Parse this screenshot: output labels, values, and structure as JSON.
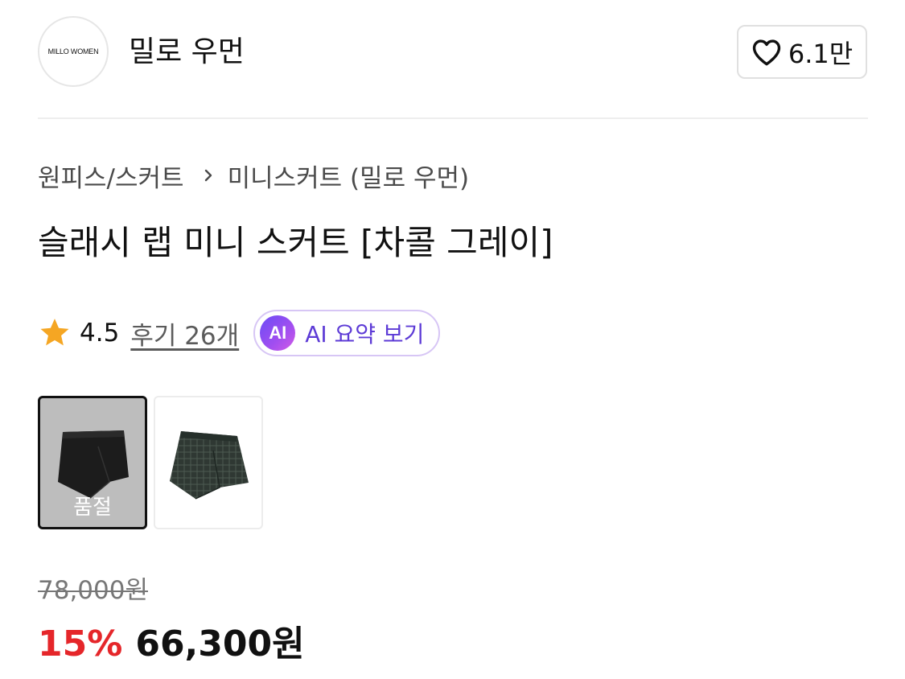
{
  "brand": {
    "logo_text": "MILLO WOMEN",
    "name": "밀로 우먼",
    "like_count": "6.1만"
  },
  "breadcrumb": {
    "category": "원피스/스커트",
    "subcategory": "미니스커트 (밀로 우먼)"
  },
  "product": {
    "title": "슬래시 랩 미니 스커트 [차콜 그레이]",
    "rating": "4.5",
    "review_link": "후기 26개",
    "ai_badge": "AI",
    "ai_summary_label": "AI 요약 보기"
  },
  "thumbnails": [
    {
      "soldout_label": "품절"
    }
  ],
  "pricing": {
    "original_price": "78,000원",
    "discount": "15%",
    "sale_price": "66,300원"
  },
  "colors": {
    "discount_red": "#e5262a",
    "ai_purple": "#5d3bd6",
    "star_orange": "#f5a623"
  }
}
